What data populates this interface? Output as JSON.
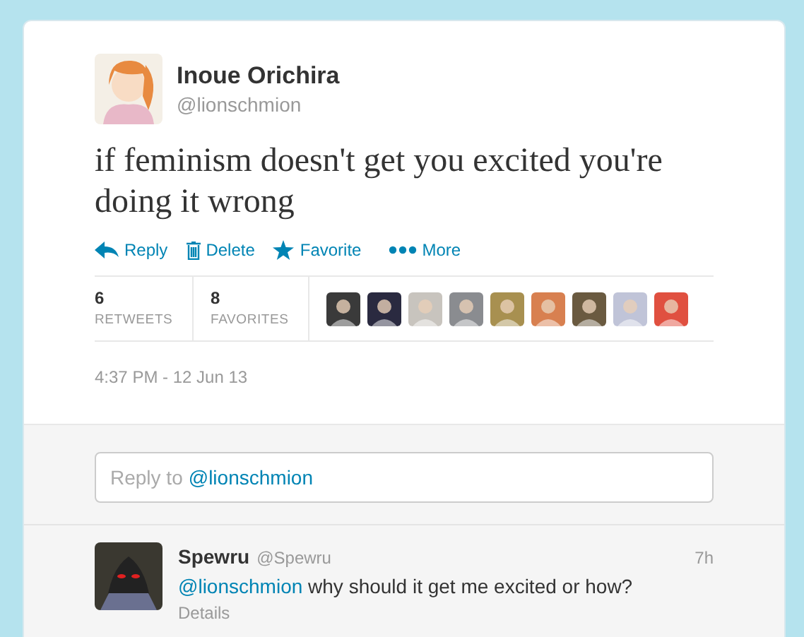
{
  "tweet": {
    "name": "Inoue Orichira",
    "handle": "@lionschmion",
    "text": "if feminism doesn't get you excited you're doing it wrong",
    "actions": [
      {
        "kind": "reply",
        "label": "Reply"
      },
      {
        "kind": "delete",
        "label": "Delete"
      },
      {
        "kind": "favorite",
        "label": "Favorite"
      },
      {
        "kind": "more",
        "label": "More"
      }
    ],
    "stats": [
      {
        "count": "6",
        "label": "RETWEETS"
      },
      {
        "count": "8",
        "label": "FAVORITES"
      }
    ],
    "favoriters": [
      {
        "color": "#3a3a3a"
      },
      {
        "color": "#2a2a40"
      },
      {
        "color": "#c8c4be"
      },
      {
        "color": "#8a8c90"
      },
      {
        "color": "#a89050"
      },
      {
        "color": "#d88050"
      },
      {
        "color": "#6a5a40"
      },
      {
        "color": "#c0c4d8"
      },
      {
        "color": "#e05040"
      }
    ],
    "timestamp": "4:37 PM - 12 Jun 13"
  },
  "reply_box": {
    "prefix": "Reply to",
    "mention": "@lionschmion"
  },
  "replies": [
    {
      "name": "Spewru",
      "handle": "@Spewru",
      "time": "7h",
      "mention": "@lionschmion",
      "text": "why should it get me excited or how?",
      "details": "Details"
    }
  ]
}
